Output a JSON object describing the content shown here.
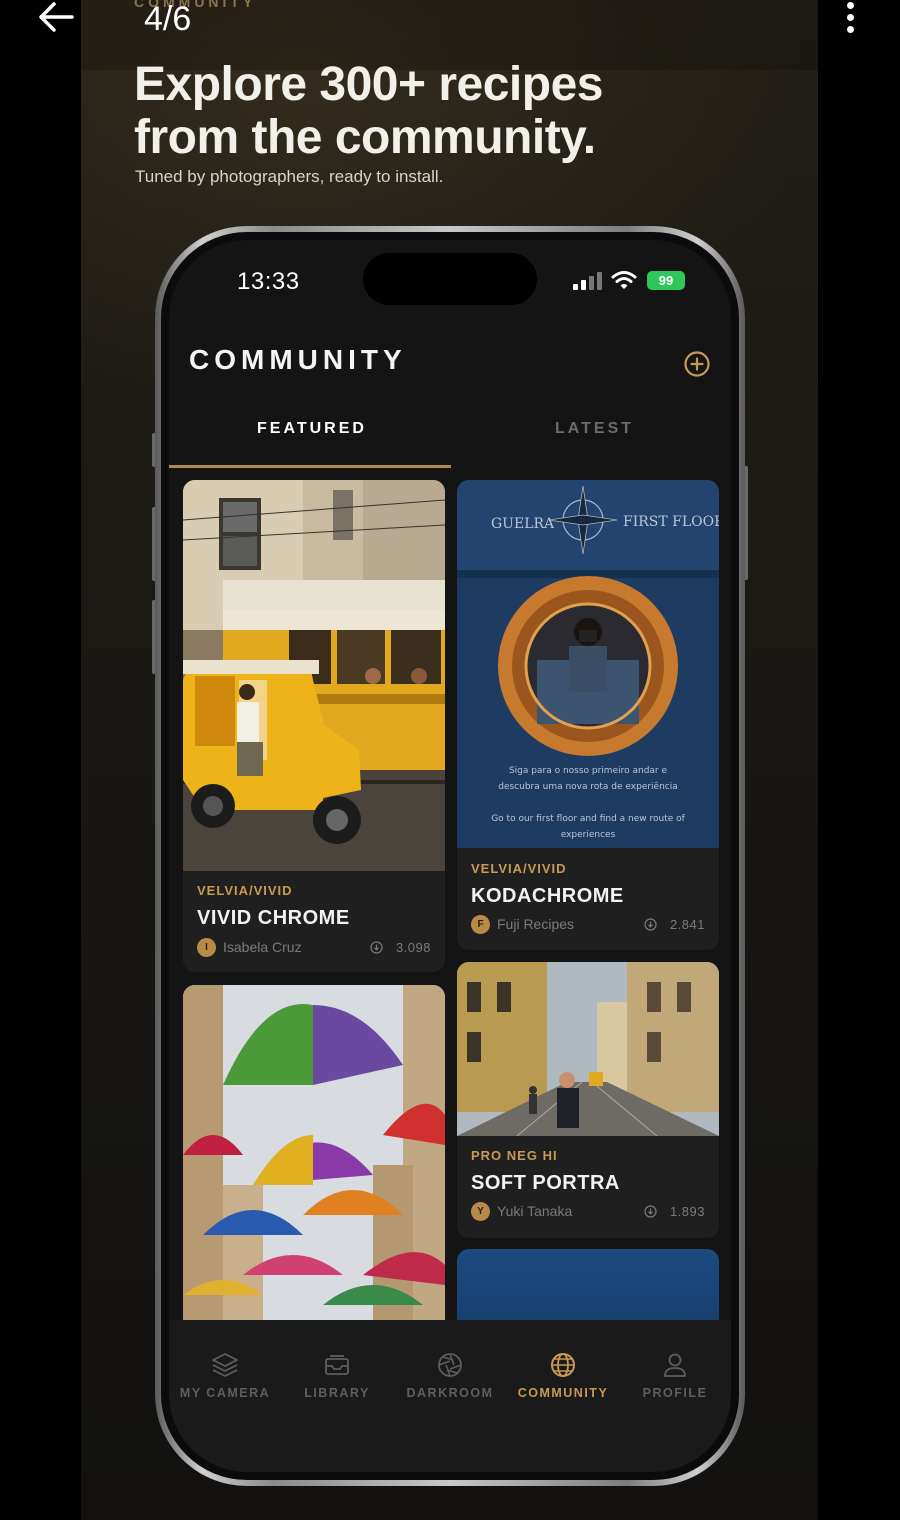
{
  "viewer": {
    "page_counter": "4/6"
  },
  "slide": {
    "eyebrow": "COMMUNITY",
    "headline_line1": "Explore 300+ recipes",
    "headline_line2": "from the community.",
    "subline": "Tuned by photographers, ready to install."
  },
  "status_bar": {
    "time": "13:33",
    "battery": "99"
  },
  "app": {
    "title": "COMMUNITY",
    "tabs": [
      {
        "label": "FEATURED",
        "active": true
      },
      {
        "label": "LATEST",
        "active": false
      }
    ]
  },
  "cards": [
    {
      "category": "VELVIA/VIVID",
      "name": "VIVID CHROME",
      "author": "Isabela Cruz",
      "author_initial": "I",
      "downloads": "3.098"
    },
    {
      "category": "VELVIA/VIVID",
      "name": "KODACHROME",
      "author": "Fuji Recipes",
      "author_initial": "F",
      "downloads": "2.841",
      "sign_left": "GUELRA",
      "sign_right": "FIRST FLOOR",
      "poster_line1": "Siga para o nosso primeiro andar e",
      "poster_line2": "descubra uma nova rota de experiência",
      "poster_line3": "Go to our first floor and find a new route of",
      "poster_line4": "experiences"
    },
    {
      "category": "PRO NEG HI",
      "name": "SOFT PORTRA",
      "author": "Yuki Tanaka",
      "author_initial": "Y",
      "downloads": "1.893"
    }
  ],
  "nav": [
    {
      "label": "MY CAMERA",
      "icon": "layers-icon",
      "active": false
    },
    {
      "label": "LIBRARY",
      "icon": "inbox-icon",
      "active": false
    },
    {
      "label": "DARKROOM",
      "icon": "aperture-icon",
      "active": false
    },
    {
      "label": "COMMUNITY",
      "icon": "globe-icon",
      "active": true
    },
    {
      "label": "PROFILE",
      "icon": "user-icon",
      "active": false
    }
  ],
  "colors": {
    "accent": "#c89a52",
    "battery": "#2fc759",
    "background": "#141414"
  }
}
